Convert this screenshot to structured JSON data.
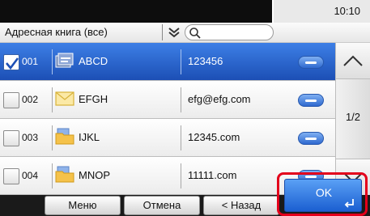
{
  "status_bar": {
    "time": "10:10"
  },
  "header": {
    "book_title": "Адресная книга (все)",
    "search_placeholder": ""
  },
  "rows": [
    {
      "number": "001",
      "type": "group",
      "name": "ABCD",
      "address": "123456",
      "checked": true,
      "selected": true
    },
    {
      "number": "002",
      "type": "email",
      "name": "EFGH",
      "address": "efg@efg.com",
      "checked": false,
      "selected": false
    },
    {
      "number": "003",
      "type": "folder",
      "name": "IJKL",
      "address": "12345.com",
      "checked": false,
      "selected": false
    },
    {
      "number": "004",
      "type": "folder",
      "name": "MNOP",
      "address": "11111.com",
      "checked": false,
      "selected": false
    }
  ],
  "pager": {
    "indicator": "1/2"
  },
  "footer": {
    "menu_label": "Меню",
    "cancel_label": "Отмена",
    "back_label": "< Назад",
    "ok_label": "OK"
  },
  "colors": {
    "selected_row": "#2a62cf",
    "highlight_outline": "#e3001b",
    "ok_button": "#2f77e0"
  }
}
